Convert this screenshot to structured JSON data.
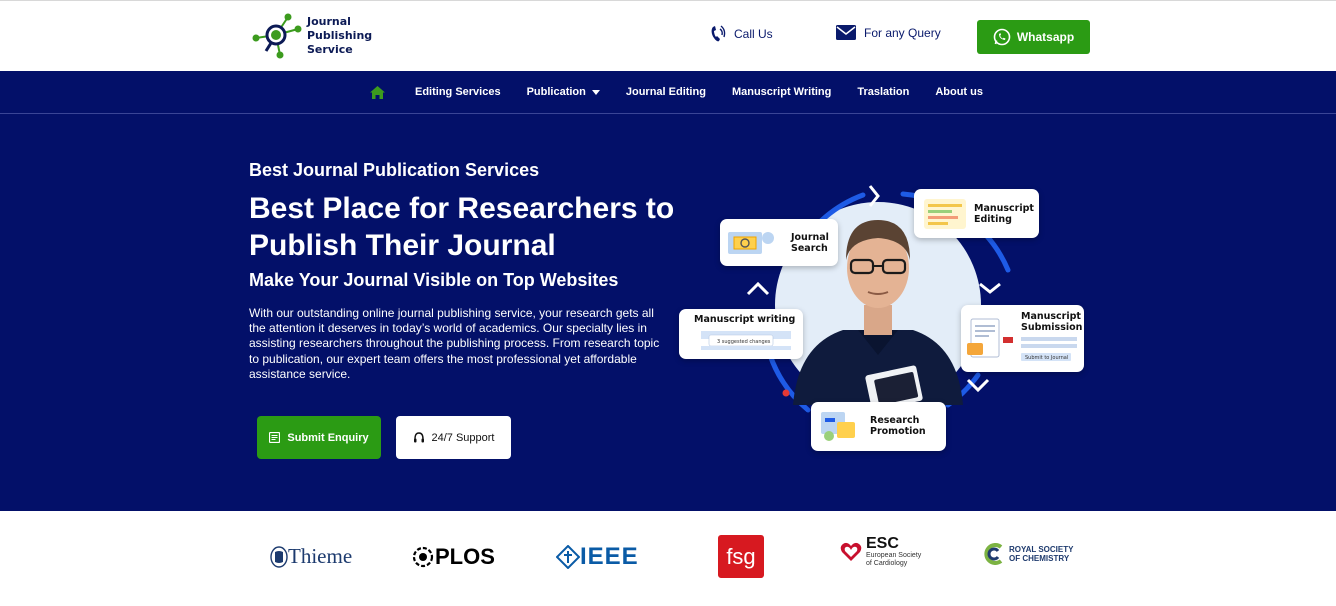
{
  "brand": {
    "line1": "Journal",
    "line2": "Publishing",
    "line3": "Service",
    "primary_color": "#031069",
    "accent_green": "#2b9b14"
  },
  "header": {
    "call_label": "Call Us",
    "query_label": "For any Query",
    "whatsapp_label": "Whatsapp"
  },
  "nav": {
    "home_icon": "home-icon",
    "items": [
      "Editing Services",
      "Publication",
      "Journal Editing",
      "Manuscript Writing",
      "Traslation",
      "About us"
    ]
  },
  "hero": {
    "eyebrow": "Best Journal Publication Services",
    "headline": "Best Place for Researchers to Publish Their Journal",
    "subheading": "Make Your Journal Visible on Top Websites",
    "description": "With our outstanding online journal publishing service, your research gets all the attention it deserves in today’s world of academics. Our specialty lies in assisting researchers throughout the publishing process. From research topic to publication, our expert team offers the most professional yet affordable assistance service.",
    "enquiry_button": "Submit Enquiry",
    "support_button": "24/7 Support"
  },
  "illustration": {
    "cards": {
      "journal_search": [
        "Journal",
        "Search"
      ],
      "manuscript_editing": [
        "Manuscript",
        "Editing"
      ],
      "manuscript_writing": "Manuscript writing",
      "suggested_changes": "3 suggested changes",
      "manuscript_submission": [
        "Manuscript",
        "Submission"
      ],
      "submit_to_journal": "Submit to Journal",
      "research_promotion": [
        "Research",
        "Promotion"
      ]
    }
  },
  "partners": {
    "thieme": "Thieme",
    "plos": "PLOS",
    "ieee": "IEEE",
    "fsg": "fsg",
    "esc": "ESC",
    "esc_sub1": "European Society",
    "esc_sub2": "of Cardiology",
    "rsc1": "ROYAL SOCIETY",
    "rsc2": "OF CHEMISTRY"
  }
}
